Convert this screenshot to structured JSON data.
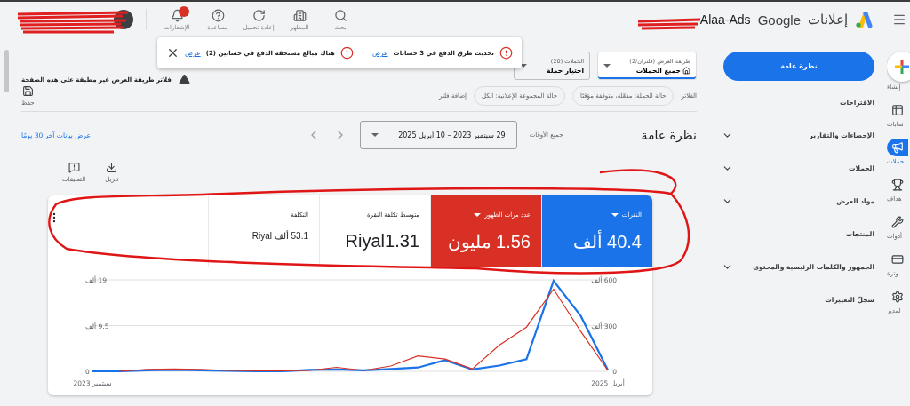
{
  "header": {
    "product": "إعلانات",
    "brand": "Google",
    "account": "Alaa-Ads",
    "tools": [
      {
        "kind": "search",
        "label": "بحث"
      },
      {
        "kind": "appearance",
        "label": "المظهر"
      },
      {
        "kind": "reload",
        "label": "إعادة تحميل"
      },
      {
        "kind": "help",
        "label": "مساعدة"
      },
      {
        "kind": "notifications",
        "label": "الإشعارات",
        "alert": true
      }
    ]
  },
  "rail": [
    {
      "kind": "create",
      "label": "إنشاء",
      "selected": false
    },
    {
      "kind": "accounts",
      "label": "سابات",
      "selected": false
    },
    {
      "kind": "campaigns",
      "label": "حملات",
      "selected": true
    },
    {
      "kind": "goals",
      "label": "هداف",
      "selected": false
    },
    {
      "kind": "tools",
      "label": "أدوات",
      "selected": false
    },
    {
      "kind": "billing",
      "label": "وترة",
      "selected": false
    },
    {
      "kind": "admin",
      "label": "لمدير",
      "selected": false
    }
  ],
  "nav": [
    {
      "label": "نظرة عامة",
      "selected": true,
      "expandable": false
    },
    {
      "label": "الاقتراحات",
      "selected": false,
      "expandable": false
    },
    {
      "label": "الإحصاءات والتقارير",
      "selected": false,
      "expandable": true
    },
    {
      "label": "الحملات",
      "selected": false,
      "expandable": true
    },
    {
      "label": "مواد العرض",
      "selected": false,
      "expandable": true
    },
    {
      "label": "المنتجات",
      "selected": false,
      "expandable": false
    },
    {
      "label": "الجمهور والكلمات الرئيسية والمحتوى",
      "selected": false,
      "expandable": true
    },
    {
      "label": "سجلّ التغييرات",
      "selected": false,
      "expandable": false
    }
  ],
  "banner": {
    "messages": [
      {
        "text": "تحديث طرق الدفع في 3 حسابات",
        "link": "عرض"
      },
      {
        "text": "هناك مبالغ مستحقة الدفع في حسابين (2)",
        "link": "عرض"
      }
    ]
  },
  "selectors": [
    {
      "kind": "view",
      "label": "طريقة العرض (فلتران/2)",
      "value": "جميع الحملات",
      "selected": true
    },
    {
      "kind": "campaign",
      "label": "الحملات (20)",
      "value": "اختيار حملة",
      "selected": false
    }
  ],
  "notice": "فلاتر طريقة العرض غير مطبقة على هذه الصفحة",
  "save": "حفظ",
  "filters": {
    "label": "الفلاتر",
    "chips": [
      "حالة الحملة: مفعّلة، متوقفة مؤقتًا",
      "حالة المجموعة الإعلانية: الكل"
    ],
    "add": "إضافة فلتر"
  },
  "overview": {
    "title": "نظرة عامة",
    "range_label": "جميع الأوقات",
    "range": "29 سبتمبر 2023 – 10 أبريل 2025",
    "link": "عرض بيانات آخر 30 يومًا"
  },
  "actions": [
    {
      "kind": "download",
      "label": "تنزيل"
    },
    {
      "kind": "feedback",
      "label": "التعليقات"
    }
  ],
  "metrics": [
    {
      "label": "النقرات",
      "value": "40.4 ألف",
      "color": "#1a73e8"
    },
    {
      "label": "عدد مرات الظهور",
      "value": "1.56 مليون",
      "color": "#d93025"
    },
    {
      "label": "متوسط تكلفة النقرة",
      "value": "Riyal1.31"
    },
    {
      "label": "التكلفة",
      "value": "53.1 ألف Riyal"
    }
  ],
  "chart_data": {
    "type": "line",
    "categories": [
      "سبتمبر 2023",
      null,
      null,
      null,
      null,
      null,
      null,
      null,
      null,
      null,
      null,
      null,
      null,
      null,
      null,
      null,
      null,
      null,
      null,
      "أبريل 2025"
    ],
    "series": [
      {
        "color": "#1a73e8",
        "values": [
          0,
          0,
          0.2,
          0.3,
          0.2,
          0.1,
          0,
          0,
          0.3,
          0.4,
          0.2,
          0.5,
          0.8,
          2.3,
          0.4,
          1.2,
          2.5,
          18.8,
          11.5,
          0.3
        ]
      },
      {
        "color": "#d93025",
        "axis": "y2",
        "values": [
          null,
          0,
          12,
          15,
          12,
          6,
          3,
          3,
          6,
          26,
          6,
          35,
          101,
          81,
          15,
          171,
          290,
          539,
          261,
          6
        ]
      }
    ],
    "ylim": [
      0,
      19
    ],
    "yticks": [
      {
        "value": 0,
        "label": "0"
      },
      {
        "value": 9.5,
        "label": "9.5 ألف"
      },
      {
        "value": 19,
        "label": "19 ألف"
      }
    ],
    "y2lim": [
      0,
      600
    ],
    "y2ticks": [
      {
        "value": 0,
        "label": "0"
      },
      {
        "value": 300,
        "label": "300 ألف"
      },
      {
        "value": 600,
        "label": "600 ألف"
      }
    ]
  }
}
